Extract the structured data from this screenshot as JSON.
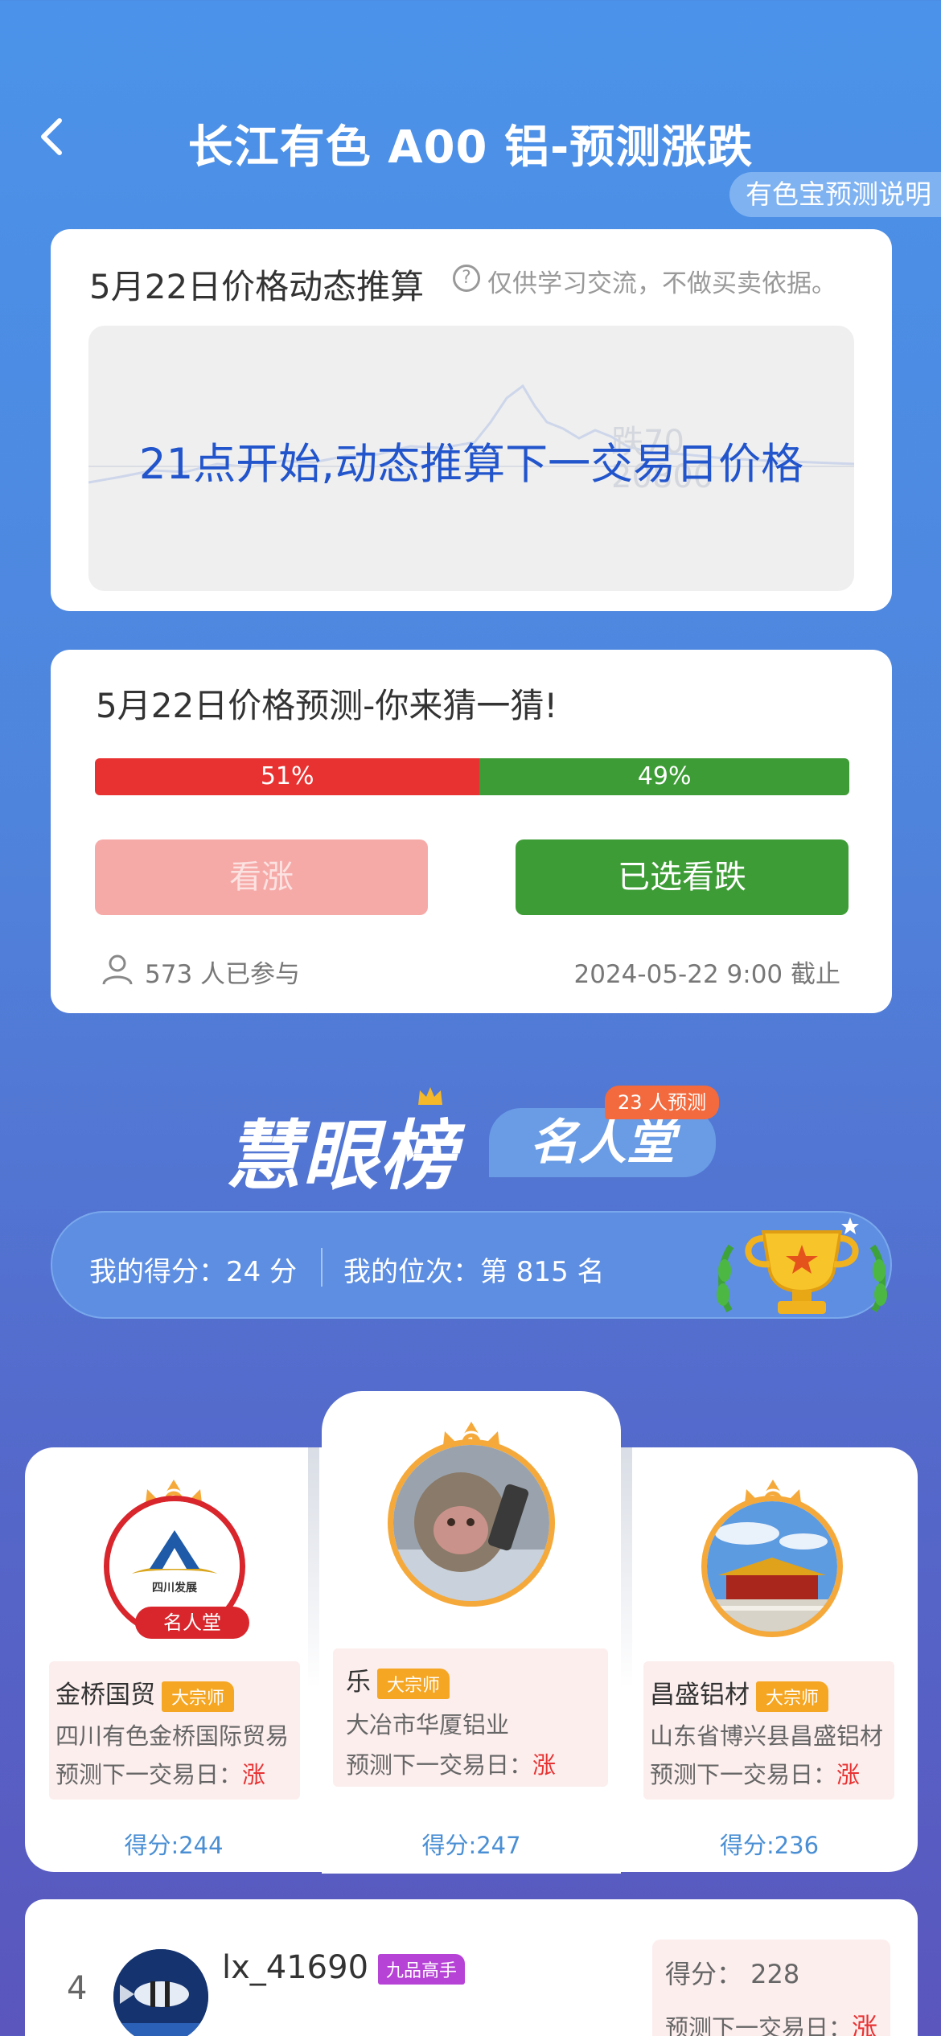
{
  "header": {
    "title": "长江有色 A00 铝-预测涨跌",
    "explain_button": "有色宝预测说明"
  },
  "dynamic_card": {
    "title": "5月22日价格动态推算",
    "note": "仅供学习交流，不做买卖依据。",
    "overlay_text": "21点开始,动态推算下一交易日价格"
  },
  "guess_card": {
    "title": "5月22日价格预测-你来猜一猜!",
    "up_percent_label": "51%",
    "down_percent_label": "49%",
    "up_fraction": 0.51,
    "up_button": "看涨",
    "down_button": "已选看跌",
    "participants": "573 人已参与",
    "deadline": "2024-05-22    9:00 截止",
    "colors": {
      "up": "#e83232",
      "down": "#3d9c35"
    }
  },
  "leaderboard": {
    "logo": "慧眼榜",
    "hall_tab": "名人堂",
    "hall_badge": "23 人预测",
    "my_score": "我的得分：24 分",
    "my_rank": "我的位次：第 815 名"
  },
  "podium": {
    "first": {
      "rank": "1",
      "name": "乐",
      "title": "大宗师",
      "company": "大冶市华厦铝业",
      "prediction_prefix": "预测下一交易日：",
      "prediction": "涨",
      "score": "得分:247"
    },
    "second": {
      "rank": "2",
      "name": "金桥国贸",
      "title": "大宗师",
      "company": "四川有色金桥国际贸易",
      "prediction_prefix": "预测下一交易日：",
      "prediction": "涨",
      "score": "得分:244",
      "hall_pill": "名人堂",
      "logo_text": "四川发展"
    },
    "third": {
      "rank": "3",
      "name": "昌盛铝材",
      "title": "大宗师",
      "company": "山东省博兴县昌盛铝材",
      "prediction_prefix": "预测下一交易日：",
      "prediction": "涨",
      "score": "得分:236"
    }
  },
  "row4": {
    "rank": "4",
    "name": "lx_41690",
    "title": "九品高手",
    "score": "得分：  228",
    "prediction_prefix": "预测下一交易日：",
    "prediction": "涨"
  }
}
